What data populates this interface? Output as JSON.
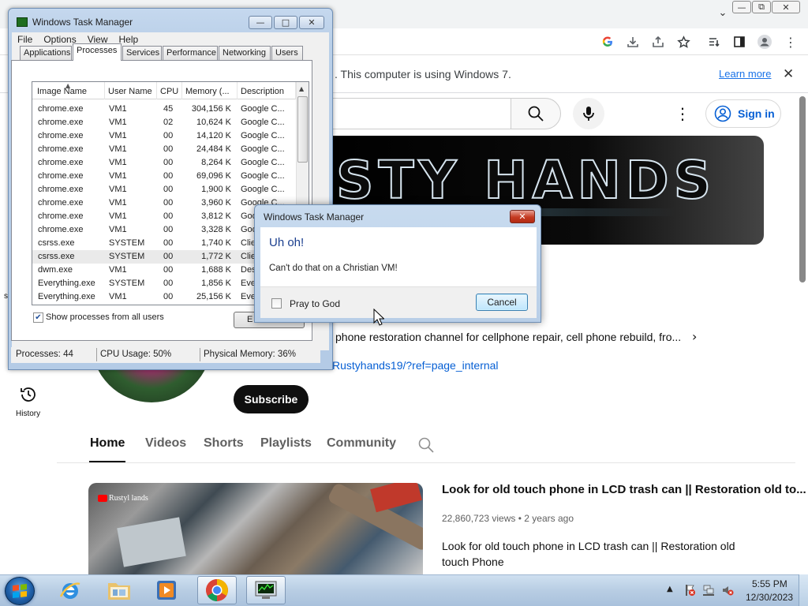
{
  "chrome": {
    "caption_buttons": [
      "—",
      "⧉",
      "✕"
    ],
    "infobar_text": ". This computer is using Windows 7.",
    "learn_more": "Learn more",
    "close_glyph": "✕",
    "tab_dropdown": "⌄"
  },
  "youtube": {
    "sign_in": "Sign in",
    "more_glyph": "⋮",
    "banner_text": "STY HANDS",
    "channel_desc": "phone restoration channel for cellphone repair, cell phone rebuild, fro...",
    "channel_desc_arrow": "›",
    "channel_link": "Rustyhands19/?ref=page_internal",
    "subscribe": "Subscribe",
    "history_label": "History",
    "side_letter": "s",
    "tabs": [
      "Home",
      "Videos",
      "Shorts",
      "Playlists",
      "Community"
    ],
    "thumb_logo_text": "Rustyl lands",
    "video": {
      "title": "Look for old touch phone in LCD trash can || Restoration old to...",
      "views": "22,860,723 views",
      "dot": "•",
      "age": "2 years ago",
      "description": "Look for old touch phone in LCD trash can || Restoration old touch Phone"
    }
  },
  "task_manager": {
    "title": "Windows Task Manager",
    "caption_buttons": [
      "—",
      "□",
      "✕"
    ],
    "menu": [
      "File",
      "Options",
      "View",
      "Help"
    ],
    "tabs": [
      "Applications",
      "Processes",
      "Services",
      "Performance",
      "Networking",
      "Users"
    ],
    "active_tab": "Processes",
    "columns": [
      "Image Name",
      "User Name",
      "CPU",
      "Memory (...",
      "Description"
    ],
    "sort_glyph": "▲",
    "rows": [
      {
        "image": "chrome.exe",
        "user": "VM1",
        "cpu": "45",
        "mem": "304,156 K",
        "desc": "Google C..."
      },
      {
        "image": "chrome.exe",
        "user": "VM1",
        "cpu": "02",
        "mem": "10,624 K",
        "desc": "Google C..."
      },
      {
        "image": "chrome.exe",
        "user": "VM1",
        "cpu": "00",
        "mem": "14,120 K",
        "desc": "Google C..."
      },
      {
        "image": "chrome.exe",
        "user": "VM1",
        "cpu": "00",
        "mem": "24,484 K",
        "desc": "Google C..."
      },
      {
        "image": "chrome.exe",
        "user": "VM1",
        "cpu": "00",
        "mem": "8,264 K",
        "desc": "Google C..."
      },
      {
        "image": "chrome.exe",
        "user": "VM1",
        "cpu": "00",
        "mem": "69,096 K",
        "desc": "Google C..."
      },
      {
        "image": "chrome.exe",
        "user": "VM1",
        "cpu": "00",
        "mem": "1,900 K",
        "desc": "Google C..."
      },
      {
        "image": "chrome.exe",
        "user": "VM1",
        "cpu": "00",
        "mem": "3,960 K",
        "desc": "Google C..."
      },
      {
        "image": "chrome.exe",
        "user": "VM1",
        "cpu": "00",
        "mem": "3,812 K",
        "desc": "Goo"
      },
      {
        "image": "chrome.exe",
        "user": "VM1",
        "cpu": "00",
        "mem": "3,328 K",
        "desc": "Goo"
      },
      {
        "image": "csrss.exe",
        "user": "SYSTEM",
        "cpu": "00",
        "mem": "1,740 K",
        "desc": "Clie"
      },
      {
        "image": "csrss.exe",
        "user": "SYSTEM",
        "cpu": "00",
        "mem": "1,772 K",
        "desc": "Clie"
      },
      {
        "image": "dwm.exe",
        "user": "VM1",
        "cpu": "00",
        "mem": "1,688 K",
        "desc": "Des"
      },
      {
        "image": "Everything.exe",
        "user": "SYSTEM",
        "cpu": "00",
        "mem": "1,856 K",
        "desc": "Eve"
      },
      {
        "image": "Everything.exe",
        "user": "VM1",
        "cpu": "00",
        "mem": "25,156 K",
        "desc": "Eve"
      }
    ],
    "show_all_label": "Show processes from all users",
    "show_all_checked": "✔",
    "end_process_partial": "E",
    "status": {
      "processes": "Processes: 44",
      "cpu": "CPU Usage: 50%",
      "memory": "Physical Memory: 36%"
    },
    "scroll_up": "▲",
    "scroll_down": "▼"
  },
  "dialog": {
    "title": "Windows Task Manager",
    "close_glyph": "✕",
    "heading": "Uh oh!",
    "message": "Can't do that on a Christian VM!",
    "checkbox_label": "Pray to God",
    "cancel": "Cancel"
  },
  "taskbar": {
    "tray_arrow": "▲",
    "time": "5:55 PM",
    "date": "12/30/2023"
  },
  "colors": {
    "youtube_blue": "#065fd4",
    "chrome_link": "#1a73e8",
    "dialog_heading": "#1a3e8e",
    "taskbar": "#b8cde3"
  }
}
